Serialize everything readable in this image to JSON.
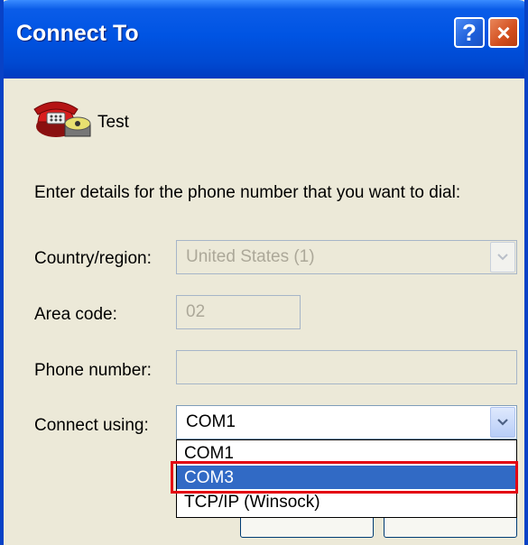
{
  "window": {
    "title": "Connect To",
    "help_label": "?",
    "close_label": "×"
  },
  "connection": {
    "icon": "phone-icon",
    "name": "Test"
  },
  "instructions": "Enter details for the phone number that you want to dial:",
  "form": {
    "country_label": "Country/region:",
    "country_value": "United States (1)",
    "area_code_label": "Area code:",
    "area_code_value": "02",
    "phone_label": "Phone number:",
    "phone_value": "",
    "connect_using_label": "Connect using:",
    "connect_using_value": "COM1"
  },
  "dropdown": {
    "options": [
      "COM1",
      "COM3",
      "TCP/IP (Winsock)"
    ],
    "selected_index": 1
  },
  "colors": {
    "titlebar": "#0054e3",
    "selection": "#316ac5",
    "highlight_border": "#e30613",
    "dialog_bg": "#ece9d8"
  }
}
